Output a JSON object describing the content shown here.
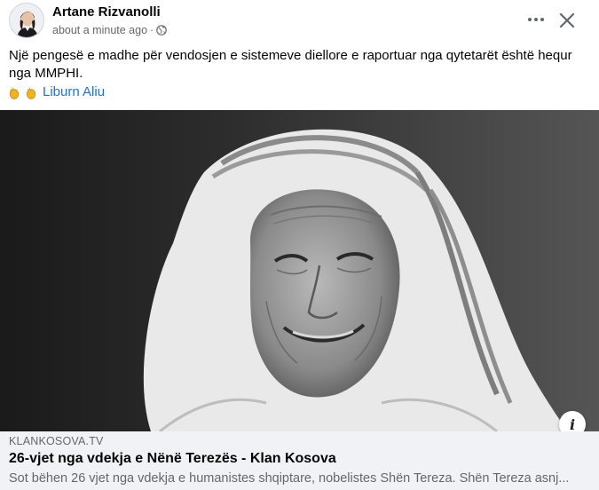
{
  "post": {
    "author": "Artane Rizvanolli",
    "timestamp": "about a minute ago",
    "separator": "·",
    "audience_icon": "globe-icon",
    "text": "Një pengesë e madhe për vendosjen e sistemeve diellore e raportuar nga qytetarët është hequr nga MMPHI.",
    "reaction_emoji": "clapping-hands",
    "mention": "Liburn Aliu"
  },
  "link_preview": {
    "domain": "KLANKOSOVA.TV",
    "title": "26-vjet nga vdekja e Nënë Terezës - Klan Kosova",
    "description": "Sot bëhen 26 vjet nga vdekja e humanistes shqiptare, nobelistes Shën Tereza. Shën Tereza asnj...",
    "info_label": "i"
  },
  "colors": {
    "link": "#216fdb",
    "secondary_text": "#65676b",
    "footer_bg": "#f0f2f5"
  }
}
